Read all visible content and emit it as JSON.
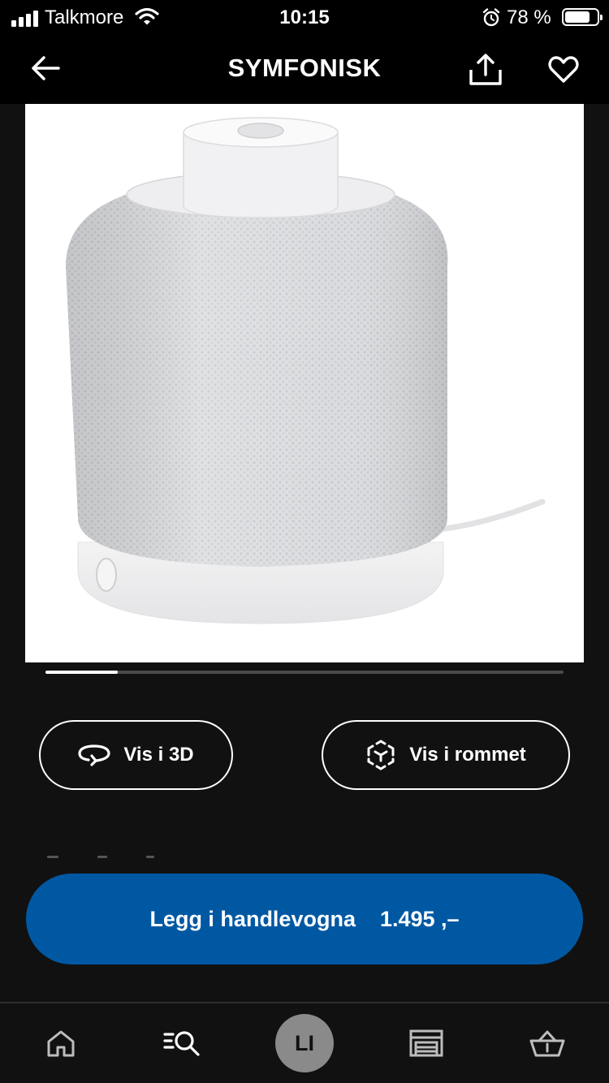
{
  "status_bar": {
    "carrier": "Talkmore",
    "time": "10:15",
    "battery_percent": "78 %",
    "battery_level": 0.78
  },
  "header": {
    "title": "SYMFONISK",
    "back_icon": "arrow-left-icon",
    "share_icon": "share-icon",
    "favorite_icon": "heart-icon"
  },
  "gallery": {
    "progress": 0.14
  },
  "actions": {
    "view_3d_label": "Vis i 3D",
    "view_3d_icon": "rotate-360-icon",
    "view_room_label": "Vis i rommet",
    "view_room_icon": "ar-cube-icon"
  },
  "cart": {
    "label": "Legg i handlevogna",
    "price": "1.495 ,–"
  },
  "tab_bar": {
    "items": [
      {
        "name": "home",
        "icon": "home-icon"
      },
      {
        "name": "search",
        "icon": "search-list-icon"
      },
      {
        "name": "profile",
        "avatar_initials": "LI"
      },
      {
        "name": "stores",
        "icon": "store-icon"
      },
      {
        "name": "cart",
        "icon": "basket-icon"
      }
    ]
  },
  "colors": {
    "background": "#111111",
    "bar_background": "#000000",
    "primary_button": "#0058a3",
    "avatar": "#8a8a8a"
  }
}
